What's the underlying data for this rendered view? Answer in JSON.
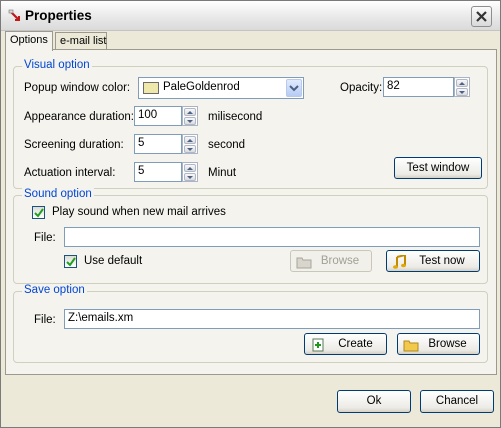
{
  "window": {
    "title": "Properties"
  },
  "tabs": [
    {
      "label": "Options",
      "active": true
    },
    {
      "label": "e-mail list",
      "active": false
    }
  ],
  "visual": {
    "legend": "Visual option",
    "popup_color_label": "Popup window color:",
    "popup_color_value": "PaleGoldenrod",
    "popup_color_hex": "#eee8aa",
    "opacity_label": "Opacity:",
    "opacity_value": "82",
    "appearance_label": "Appearance duration:",
    "appearance_value": "100",
    "appearance_unit": "milisecond",
    "screening_label": "Screening duration:",
    "screening_value": "5",
    "screening_unit": "second",
    "actuation_label": "Actuation interval:",
    "actuation_value": "5",
    "actuation_unit": "Minut",
    "test_window_button": "Test window"
  },
  "sound": {
    "legend": "Sound option",
    "play_sound_label": "Play sound when new mail arrives",
    "play_sound_checked": true,
    "file_label": "File:",
    "file_value": "",
    "use_default_label": "Use default",
    "use_default_checked": true,
    "browse_button": "Browse",
    "browse_enabled": false,
    "test_now_button": "Test now"
  },
  "save": {
    "legend": "Save option",
    "file_label": "File:",
    "file_value": "Z:\\emails.xm",
    "create_button": "Create",
    "browse_button": "Browse"
  },
  "footer": {
    "ok_button": "Ok",
    "cancel_button": "Chancel"
  },
  "icons": {
    "app": "envelope-arrow-icon",
    "close": "close-icon",
    "dropdown": "chevron-down-icon",
    "spin_up": "spin-up-icon",
    "spin_down": "spin-down-icon",
    "check": "check-icon",
    "folder": "folder-icon",
    "music_note": "music-note-icon",
    "create": "new-document-icon"
  }
}
